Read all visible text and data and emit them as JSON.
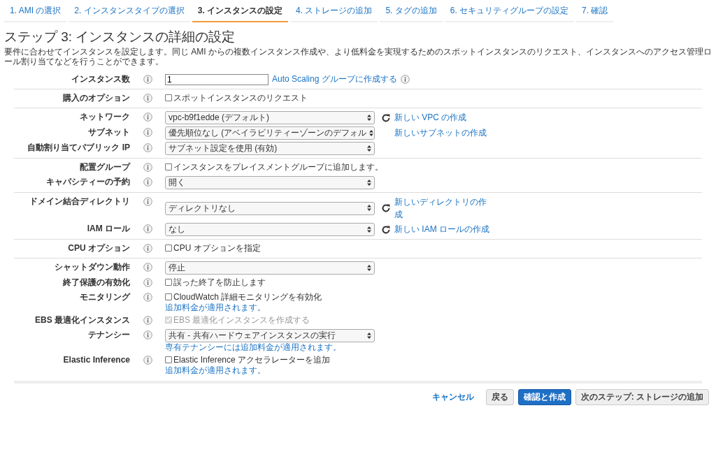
{
  "tabs": [
    {
      "label": "1. AMI の選択",
      "selected": false
    },
    {
      "label": "2. インスタンスタイプの選択",
      "selected": false
    },
    {
      "label": "3. インスタンスの設定",
      "selected": true
    },
    {
      "label": "4. ストレージの追加",
      "selected": false
    },
    {
      "label": "5. タグの追加",
      "selected": false
    },
    {
      "label": "6. セキュリティグループの設定",
      "selected": false
    },
    {
      "label": "7. 確認",
      "selected": false
    }
  ],
  "title": "ステップ 3: インスタンスの詳細の設定",
  "description": "要件に合わせてインスタンスを設定します。同じ AMI からの複数インスタンス作成や、より低料金を実現するためのスポットインスタンスのリクエスト、インスタンスへのアクセス管理ロール割り当てなどを行うことができます。",
  "sections": [
    {
      "rows": [
        {
          "label": "インスタンス数",
          "kind": "input",
          "value": "1",
          "link": "Auto Scaling グループに作成する",
          "link_info": true
        }
      ]
    },
    {
      "rows": [
        {
          "label": "購入のオプション",
          "kind": "checkbox",
          "text": "スポットインスタンスのリクエスト",
          "checked": false,
          "disabled": false
        }
      ]
    },
    {
      "rows": [
        {
          "label": "ネットワーク",
          "kind": "select",
          "value": "vpc-b9f1edde (デフォルト)",
          "refresh": true,
          "link": "新しい VPC の作成"
        },
        {
          "label": "サブネット",
          "kind": "select",
          "value": "優先順位なし (アベイラビリティーゾーンのデフォル",
          "refresh": false,
          "link": "新しいサブネットの作成"
        },
        {
          "label": "自動割り当てパブリック IP",
          "kind": "select",
          "value": "サブネット設定を使用 (有効)",
          "refresh": false
        }
      ]
    },
    {
      "rows": [
        {
          "label": "配置グループ",
          "kind": "checkbox",
          "text": "インスタンスをプレイスメントグループに追加します。",
          "checked": false,
          "disabled": false
        },
        {
          "label": "キャパシティーの予約",
          "kind": "select",
          "value": "開く",
          "refresh": false
        }
      ]
    },
    {
      "rows": [
        {
          "label": "ドメイン結合ディレクトリ",
          "kind": "select",
          "value": "ディレクトリなし",
          "refresh": true,
          "link": "新しいディレクトリの作成"
        },
        {
          "label": "IAM ロール",
          "kind": "select",
          "value": "なし",
          "refresh": true,
          "link": "新しい IAM ロールの作成"
        }
      ]
    },
    {
      "rows": [
        {
          "label": "CPU オプション",
          "kind": "checkbox",
          "text": "CPU オプションを指定",
          "checked": false,
          "disabled": false
        }
      ]
    },
    {
      "rows": [
        {
          "label": "シャットダウン動作",
          "kind": "select",
          "value": "停止",
          "refresh": false
        },
        {
          "label": "終了保護の有効化",
          "kind": "checkbox",
          "text": "誤った終了を防止します",
          "checked": false,
          "disabled": false
        },
        {
          "label": "モニタリング",
          "kind": "checkbox",
          "text": "CloudWatch 詳細モニタリングを有効化",
          "checked": false,
          "disabled": false,
          "note": "追加料金が適用されます。"
        },
        {
          "label": "EBS 最適化インスタンス",
          "kind": "checkbox",
          "text": "EBS 最適化インスタンスを作成する",
          "checked": true,
          "disabled": true
        },
        {
          "label": "テナンシー",
          "kind": "select",
          "value": "共有 - 共有ハードウェアインスタンスの実行",
          "refresh": false,
          "note": "専有テナンシーには追加料金が適用されます。"
        },
        {
          "label": "Elastic Inference",
          "kind": "checkbox",
          "text": "Elastic Inference アクセラレーターを追加",
          "checked": false,
          "disabled": false,
          "note": "追加料金が適用されます。"
        }
      ]
    }
  ],
  "buttons": [
    {
      "label": "キャンセル",
      "kind": "link"
    },
    {
      "label": "戻る",
      "kind": "secondary"
    },
    {
      "label": "確認と作成",
      "kind": "primary"
    },
    {
      "label": "次のステップ: ストレージの追加",
      "kind": "secondary"
    }
  ]
}
